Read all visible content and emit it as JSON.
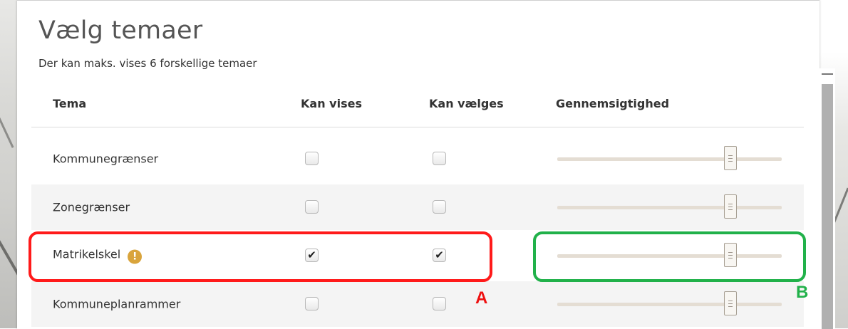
{
  "dialog": {
    "title": "Vælg temaer",
    "subtitle": "Der kan maks. vises 6 forskellige temaer"
  },
  "table": {
    "headers": {
      "tema": "Tema",
      "kan_vises": "Kan vises",
      "kan_vaelges": "Kan vælges",
      "gennemsigtighed": "Gennemsigtighed"
    },
    "rows": [
      {
        "name": "Kommunegrænser",
        "kan_vises": false,
        "kan_vaelges": false,
        "opacity_fraction": 0.77,
        "warning": false
      },
      {
        "name": "Zonegrænser",
        "kan_vises": false,
        "kan_vaelges": false,
        "opacity_fraction": 0.77,
        "warning": false
      },
      {
        "name": "Matrikelskel",
        "kan_vises": true,
        "kan_vaelges": true,
        "opacity_fraction": 0.77,
        "warning": true,
        "warning_glyph": "!"
      },
      {
        "name": "Kommuneplanrammer",
        "kan_vises": false,
        "kan_vaelges": false,
        "opacity_fraction": 0.77,
        "warning": false
      }
    ]
  },
  "annotations": {
    "a_label": "A",
    "b_label": "B",
    "a_color": "#ff1a1a",
    "b_color": "#21b14a"
  },
  "icons": {
    "warning": "warning-exclamation-icon",
    "checkmark": "✔"
  }
}
